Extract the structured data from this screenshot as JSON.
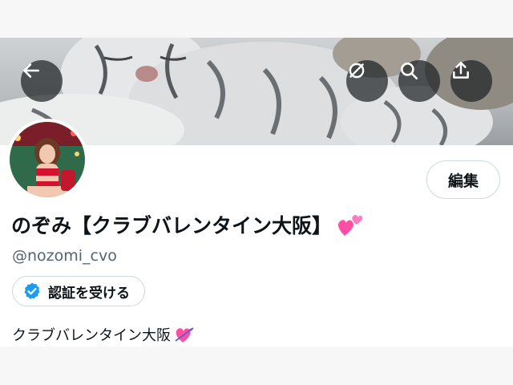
{
  "profile": {
    "display_name": "のぞみ【クラブバレンタイン大阪】",
    "handle": "@nozomi_cvo",
    "bio": "クラブバレンタイン大阪",
    "edit_label": "編集",
    "verify_label": "認証を受ける"
  },
  "icons": {
    "back": "arrow-left-icon",
    "translate": "no-translate-icon",
    "search": "search-icon",
    "share": "share-icon",
    "verified": "verified-badge-icon",
    "name_emoji": "two-hearts-emoji",
    "bio_emoji": "heart-with-arrow-emoji"
  },
  "colors": {
    "accent_blue": "#1d9bf0",
    "text_primary": "#0f1419",
    "text_secondary": "#536471",
    "border": "#cfd9de",
    "heart_pink": "#ff4fa3"
  }
}
